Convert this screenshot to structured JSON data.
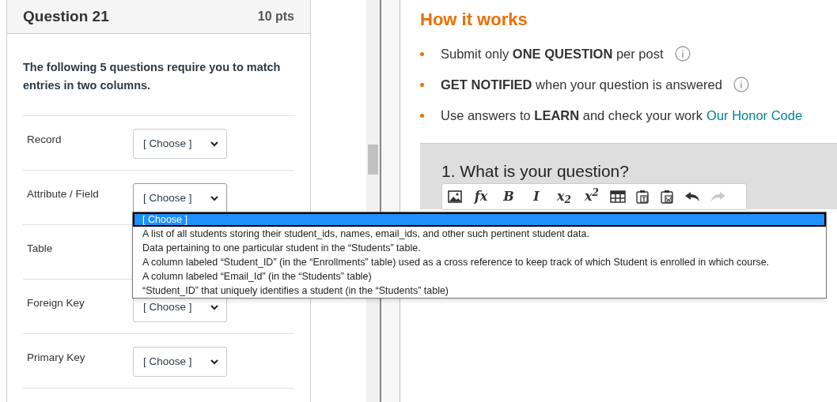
{
  "question": {
    "title": "Question 21",
    "points": "10 pts",
    "prompt": "The following 5 questions require you to match entries in two columns.",
    "rows": [
      {
        "label": "Record",
        "value": "[ Choose ]",
        "expanded": false
      },
      {
        "label": "Attribute / Field",
        "value": "[ Choose ]",
        "expanded": true
      },
      {
        "label": "Table"
      },
      {
        "label": "Foreign Key",
        "value": "[ Choose ]",
        "expanded": false
      },
      {
        "label": "Primary Key",
        "value": "[ Choose ]",
        "expanded": false
      }
    ],
    "options": [
      {
        "text": "[ Choose ]",
        "selected": true
      },
      {
        "text": "A list of all students storing their student_ids, names, email_ids, and other such pertinent student data.",
        "selected": false
      },
      {
        "text": "Data pertaining to one particular student in the “Students” table.",
        "selected": false
      },
      {
        "text": "A column labeled “Student_ID” (in the “Enrollments” table) used as a cross reference to keep track of which Student is enrolled in which course.",
        "selected": false
      },
      {
        "text": "A column labeled “Email_Id” (in the “Students” table)",
        "selected": false
      },
      {
        "text": "“Student_ID” that uniquely identifies a student (in the “Students” table)",
        "selected": false
      }
    ]
  },
  "how_it_works": {
    "title": "How it works",
    "items": [
      {
        "text": "Submit only **ONE QUESTION** per post",
        "info": true
      },
      {
        "text": "**GET NOTIFIED** when your question is answered",
        "info": true
      },
      {
        "text": "Use answers to **LEARN** and check your work",
        "info": false,
        "link": "Our Honor Code"
      }
    ]
  },
  "editor": {
    "title": "1. What is your question?",
    "toolbar": [
      {
        "kind": "image",
        "disabled": false
      },
      {
        "kind": "glyph",
        "label": "fx",
        "disabled": false
      },
      {
        "kind": "glyph",
        "label": "B",
        "disabled": false
      },
      {
        "kind": "glyph",
        "label": "I",
        "disabled": false
      },
      {
        "kind": "glyph",
        "label": "x$_{2}$",
        "disabled": false
      },
      {
        "kind": "glyph",
        "label": "x$^{2}$",
        "disabled": false
      },
      {
        "kind": "table",
        "disabled": false
      },
      {
        "kind": "paste-text",
        "disabled": false
      },
      {
        "kind": "paste-word",
        "disabled": false
      },
      {
        "kind": "undo",
        "disabled": false
      },
      {
        "kind": "redo",
        "disabled": true
      }
    ]
  }
}
